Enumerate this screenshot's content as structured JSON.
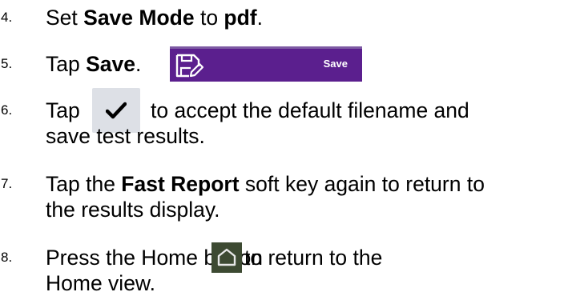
{
  "steps": [
    {
      "number": "4.",
      "parts": {
        "pre": "Set ",
        "b1": "Save Mode",
        "mid": " to ",
        "b2": "pdf",
        "post": "."
      }
    },
    {
      "number": "5.",
      "parts": {
        "pre": "Tap ",
        "b1": "Save",
        "post": "."
      },
      "button_label": "Save",
      "icon": "floppy-disk-edit-icon",
      "button_color": "#5b1f8e"
    },
    {
      "number": "6.",
      "pre": "Tap",
      "line1_after": "to accept the default filename and",
      "line2": "save test results.",
      "icon": "checkmark-icon",
      "button_color": "#dde0e6"
    },
    {
      "number": "7.",
      "parts": {
        "pre": "Tap the ",
        "b1": "Fast Report",
        "post": " soft key again to return to"
      },
      "line2": "the results display."
    },
    {
      "number": "8.",
      "pre": "Press the Home button",
      "line1_after": "to return to the",
      "line2": "Home view.",
      "icon": "home-icon",
      "button_color": "#3d4a32"
    }
  ]
}
